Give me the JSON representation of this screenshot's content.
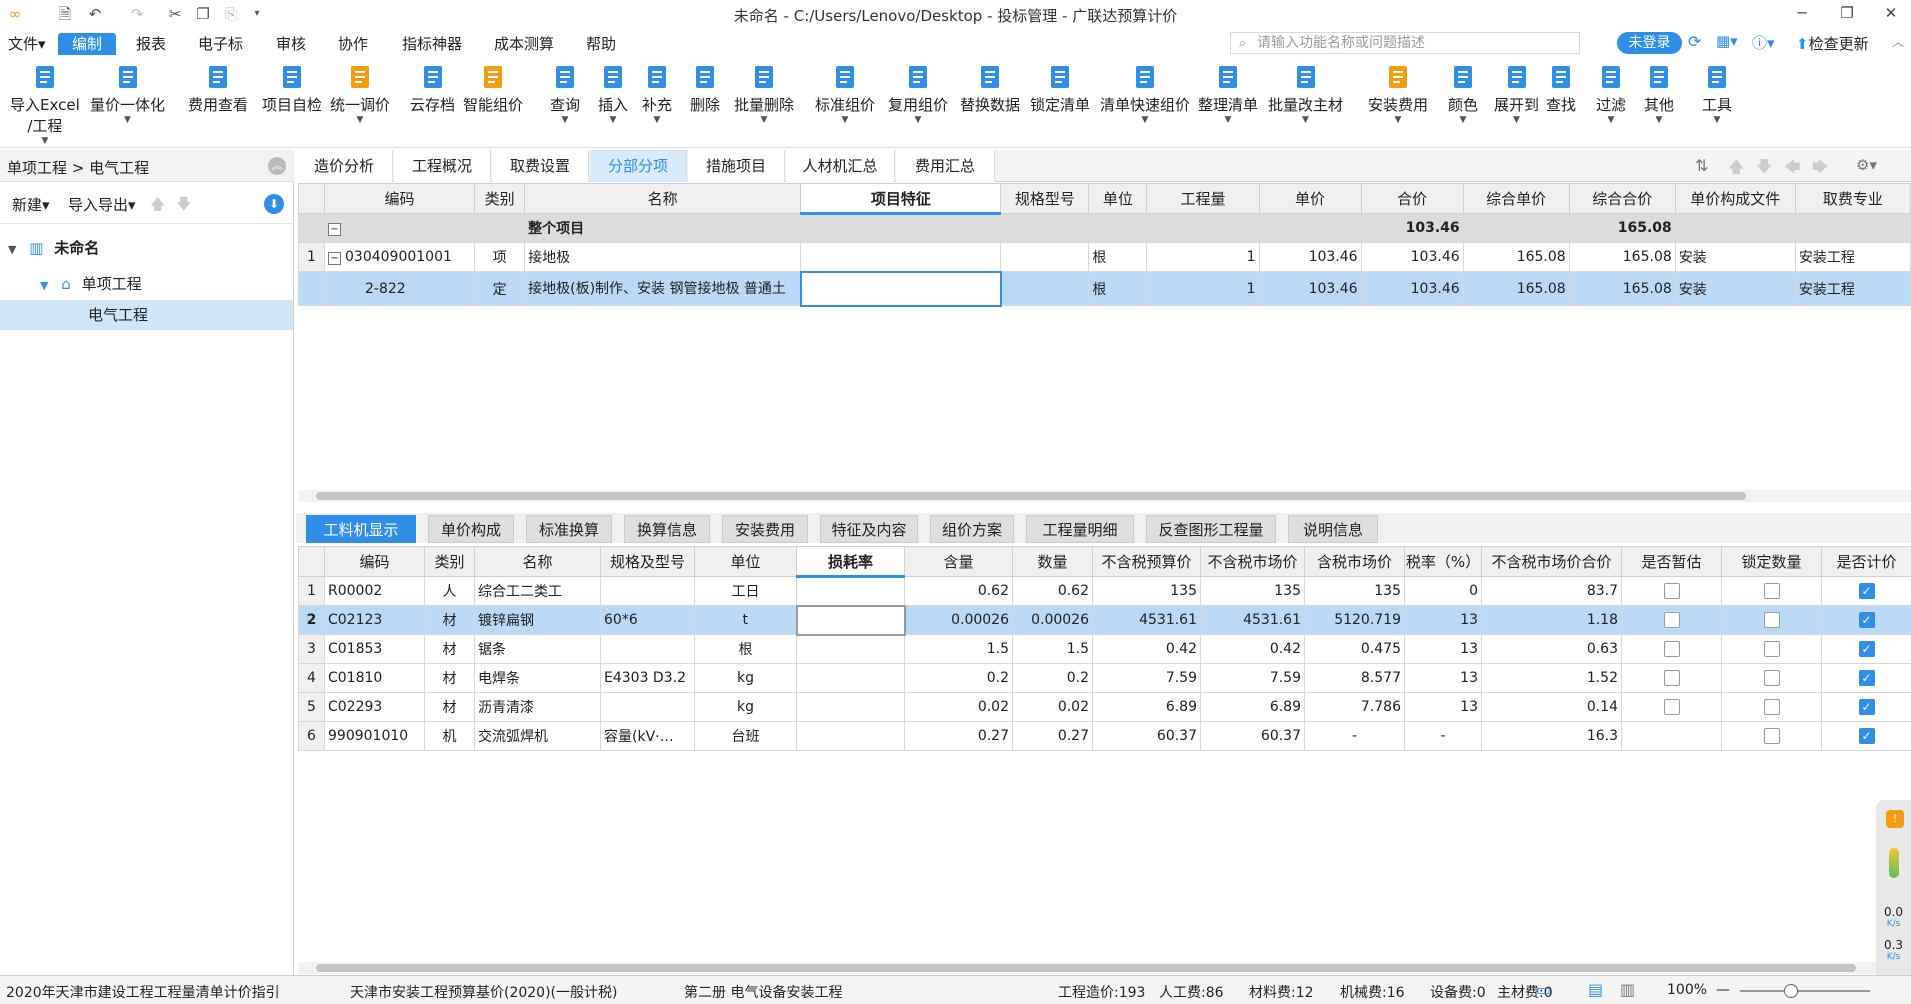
{
  "window": {
    "title": "未命名 - C:/Users/Lenovo/Desktop - 投标管理 - 广联达预算计价"
  },
  "menu": {
    "items": [
      "文件",
      "编制",
      "报表",
      "电子标",
      "审核",
      "协作",
      "指标神器",
      "成本测算",
      "帮助"
    ],
    "search_placeholder": "请输入功能名称或问题描述",
    "login": "未登录",
    "check_update": "检查更新"
  },
  "toolbar": {
    "items": [
      {
        "label": "导入Excel",
        "label2": "/工程",
        "icon": "import-excel-icon"
      },
      {
        "label": "量价一体化",
        "icon": "quantity-price-icon"
      },
      {
        "label": "费用查看",
        "icon": "fee-view-icon"
      },
      {
        "label": "项目自检",
        "icon": "self-check-icon"
      },
      {
        "label": "统一调价",
        "icon": "adjust-price-icon"
      },
      {
        "label": "云存档",
        "icon": "cloud-save-icon"
      },
      {
        "label": "智能组价",
        "icon": "smart-price-icon"
      },
      {
        "label": "查询",
        "icon": "query-icon"
      },
      {
        "label": "插入",
        "icon": "insert-icon"
      },
      {
        "label": "补充",
        "icon": "supplement-icon"
      },
      {
        "label": "删除",
        "icon": "delete-icon"
      },
      {
        "label": "批量删除",
        "icon": "batch-delete-icon"
      },
      {
        "label": "标准组价",
        "icon": "standard-price-icon"
      },
      {
        "label": "复用组价",
        "icon": "reuse-price-icon"
      },
      {
        "label": "替换数据",
        "icon": "replace-data-icon"
      },
      {
        "label": "锁定清单",
        "icon": "lock-list-icon"
      },
      {
        "label": "清单快速组价",
        "icon": "quick-price-icon"
      },
      {
        "label": "整理清单",
        "icon": "organize-list-icon"
      },
      {
        "label": "批量改主材",
        "icon": "batch-material-icon"
      },
      {
        "label": "安装费用",
        "icon": "install-fee-icon"
      },
      {
        "label": "颜色",
        "icon": "color-icon"
      },
      {
        "label": "展开到",
        "icon": "expand-icon"
      },
      {
        "label": "查找",
        "icon": "find-icon"
      },
      {
        "label": "过滤",
        "icon": "filter-icon"
      },
      {
        "label": "其他",
        "icon": "other-icon"
      },
      {
        "label": "工具",
        "icon": "tools-icon"
      }
    ]
  },
  "left_panel": {
    "breadcrumb": "单项工程 > 电气工程",
    "new_label": "新建",
    "import_export_label": "导入导出",
    "tree": [
      "未命名",
      "单项工程",
      "电气工程"
    ]
  },
  "main_tabs": [
    "造价分析",
    "工程概况",
    "取费设置",
    "分部分项",
    "措施项目",
    "人材机汇总",
    "费用汇总"
  ],
  "upper_table": {
    "headers": [
      "编码",
      "类别",
      "名称",
      "项目特征",
      "规格型号",
      "单位",
      "工程量",
      "单价",
      "合价",
      "综合单价",
      "综合合价",
      "单价构成文件",
      "取费专业"
    ],
    "summary": {
      "name": "整个项目",
      "total": "103.46",
      "comp_total": "165.08"
    },
    "rows": [
      {
        "idx": "1",
        "code": "030409001001",
        "type": "项",
        "name": "接地极",
        "feature": "",
        "spec": "",
        "unit": "根",
        "qty": "1",
        "price": "103.46",
        "total": "103.46",
        "comp_price": "165.08",
        "comp_total": "165.08",
        "file": "安装",
        "major": "安装工程"
      },
      {
        "idx": "",
        "code": "2-822",
        "type": "定",
        "name": "接地极(板)制作、安装 钢管接地极 普通土",
        "feature": "",
        "spec": "",
        "unit": "根",
        "qty": "1",
        "price": "103.46",
        "total": "103.46",
        "comp_price": "165.08",
        "comp_total": "165.08",
        "file": "安装",
        "major": "安装工程"
      }
    ]
  },
  "bottom_tabs": [
    "工料机显示",
    "单价构成",
    "标准换算",
    "换算信息",
    "安装费用",
    "特征及内容",
    "组价方案",
    "工程量明细",
    "反查图形工程量",
    "说明信息"
  ],
  "lower_table": {
    "headers": [
      "编码",
      "类别",
      "名称",
      "规格及型号",
      "单位",
      "损耗率",
      "含量",
      "数量",
      "不含税预算价",
      "不含税市场价",
      "含税市场价",
      "税率（%）",
      "不含税市场价合价",
      "是否暂估",
      "锁定数量",
      "是否计价"
    ],
    "rows": [
      {
        "idx": "1",
        "code": "R00002",
        "type": "人",
        "name": "综合工二类工",
        "spec": "",
        "unit": "工日",
        "loss": "",
        "content": "0.62",
        "qty": "0.62",
        "budget": "135",
        "market": "135",
        "market_tax": "135",
        "tax": "0",
        "sum": "83.7",
        "est": false,
        "lock": false,
        "price": true
      },
      {
        "idx": "2",
        "code": "C02123",
        "type": "材",
        "name": "镀锌扁钢",
        "spec": "60*6",
        "unit": "t",
        "loss": "",
        "content": "0.00026",
        "qty": "0.00026",
        "budget": "4531.61",
        "market": "4531.61",
        "market_tax": "5120.719",
        "tax": "13",
        "sum": "1.18",
        "est": false,
        "lock": false,
        "price": true
      },
      {
        "idx": "3",
        "code": "C01853",
        "type": "材",
        "name": "锯条",
        "spec": "",
        "unit": "根",
        "loss": "",
        "content": "1.5",
        "qty": "1.5",
        "budget": "0.42",
        "market": "0.42",
        "market_tax": "0.475",
        "tax": "13",
        "sum": "0.63",
        "est": false,
        "lock": false,
        "price": true
      },
      {
        "idx": "4",
        "code": "C01810",
        "type": "材",
        "name": "电焊条",
        "spec": "E4303 D3.2",
        "unit": "kg",
        "loss": "",
        "content": "0.2",
        "qty": "0.2",
        "budget": "7.59",
        "market": "7.59",
        "market_tax": "8.577",
        "tax": "13",
        "sum": "1.52",
        "est": false,
        "lock": false,
        "price": true
      },
      {
        "idx": "5",
        "code": "C02293",
        "type": "材",
        "name": "沥青清漆",
        "spec": "",
        "unit": "kg",
        "loss": "",
        "content": "0.02",
        "qty": "0.02",
        "budget": "6.89",
        "market": "6.89",
        "market_tax": "7.786",
        "tax": "13",
        "sum": "0.14",
        "est": false,
        "lock": false,
        "price": true
      },
      {
        "idx": "6",
        "code": "990901010",
        "type": "机",
        "name": "交流弧焊机",
        "spec": "容量(kV·…",
        "unit": "台班",
        "loss": "",
        "content": "0.27",
        "qty": "0.27",
        "budget": "60.37",
        "market": "60.37",
        "market_tax": "-",
        "tax": "-",
        "sum": "16.3",
        "est": null,
        "lock": false,
        "price": true
      }
    ]
  },
  "status": {
    "norm1": "2020年天津市建设工程工程量清单计价指引",
    "norm2": "天津市安装工程预算基价(2020)(一般计税)",
    "norm3": "第二册 电气设备安装工程",
    "cost": "工程造价:193",
    "labor": "人工费:86",
    "material": "材料费:12",
    "machine": "机械费:16",
    "equipment": "设备费:0",
    "main_material": "主材费:0",
    "zoom": "100%"
  },
  "float_widget": {
    "v1": "0.0",
    "u1": "K/s",
    "v2": "0.3",
    "u2": "K/s"
  }
}
